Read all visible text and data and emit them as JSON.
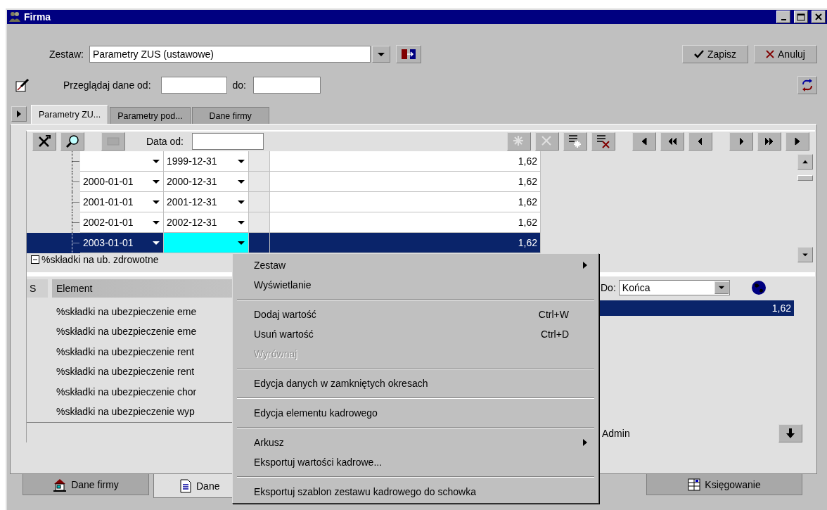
{
  "window": {
    "title": "Firma"
  },
  "set_row": {
    "label": "Zestaw:",
    "value": "Parametry ZUS (ustawowe)"
  },
  "actions": [
    {
      "label": "Zapisz",
      "kind": "save"
    },
    {
      "label": "Anuluj",
      "kind": "cancel"
    }
  ],
  "browse": {
    "label": "Przeglądaj dane od:",
    "to_label": "do:"
  },
  "tabs": [
    {
      "label": "Parametry ZU...",
      "selected": true
    },
    {
      "label": "Parametry pod...",
      "selected": false
    },
    {
      "label": "Dane firmy",
      "selected": false
    }
  ],
  "toolbar": {
    "date_label": "Data od:",
    "buttons": [
      {
        "kind": "new",
        "disabled": true
      },
      {
        "kind": "delete",
        "disabled": true
      },
      {
        "kind": "add-row",
        "disabled": false
      },
      {
        "kind": "remove-row",
        "disabled": false
      }
    ]
  },
  "grid": {
    "rows": [
      {
        "to": "1999-12-31",
        "value": "1,62",
        "selected": false
      },
      {
        "from": "2000-01-01",
        "to": "2000-12-31",
        "value": "1,62",
        "selected": false
      },
      {
        "from": "2001-01-01",
        "to": "2001-12-31",
        "value": "1,62",
        "selected": false
      },
      {
        "from": "2002-01-01",
        "to": "2002-12-31",
        "value": "1,62",
        "selected": false
      },
      {
        "from": "2003-01-01",
        "value": "1,62",
        "selected": true
      }
    ],
    "node": {
      "label": "%składki na ub. zdrowotne",
      "expanded": true
    }
  },
  "list": {
    "columns": [
      "S",
      "Element"
    ],
    "rows": [
      "%składki na ubezpieczenie eme",
      "%składki na ubezpieczenie eme",
      "%składki na ubezpieczenie rent",
      "%składki na ubezpieczenie rent",
      "%składki na ubezpieczenie chor",
      "%składki na ubezpieczenie wyp"
    ]
  },
  "detail": {
    "to_label": "Do:",
    "to_value": "Końca",
    "selected_value": "1,62",
    "user": "Admin"
  },
  "bottom_tabs": [
    {
      "label": "Dane firmy",
      "kind": "house",
      "selected": false
    },
    {
      "label": "Dane",
      "kind": "document",
      "selected": true
    },
    {
      "label": "Księgowanie",
      "kind": "grid",
      "selected": false
    }
  ],
  "context_menu": {
    "items": [
      {
        "kind": "item",
        "label": "Zestaw",
        "submenu": true,
        "disabled": false
      },
      {
        "kind": "item",
        "label": "Wyświetlanie",
        "submenu": false,
        "disabled": false
      },
      {
        "kind": "separator"
      },
      {
        "kind": "item",
        "label": "Dodaj wartość",
        "shortcut": "Ctrl+W",
        "submenu": false,
        "disabled": false
      },
      {
        "kind": "item",
        "label": "Usuń wartość",
        "shortcut": "Ctrl+D",
        "submenu": false,
        "disabled": false
      },
      {
        "kind": "item",
        "label": "Wyrównaj",
        "submenu": false,
        "disabled": true
      },
      {
        "kind": "separator"
      },
      {
        "kind": "item",
        "label": "Edycja danych w zamkniętych okresach",
        "submenu": false,
        "disabled": false
      },
      {
        "kind": "separator"
      },
      {
        "kind": "item",
        "label": "Edycja elementu kadrowego",
        "submenu": false,
        "disabled": false
      },
      {
        "kind": "separator"
      },
      {
        "kind": "item",
        "label": "Arkusz",
        "submenu": true,
        "disabled": false
      },
      {
        "kind": "item",
        "label": "Eksportuj wartości kadrowe...",
        "submenu": false,
        "disabled": false
      },
      {
        "kind": "separator"
      },
      {
        "kind": "item",
        "label": "Eksportuj szablon zestawu kadrowego do schowka",
        "submenu": false,
        "disabled": false
      }
    ]
  }
}
